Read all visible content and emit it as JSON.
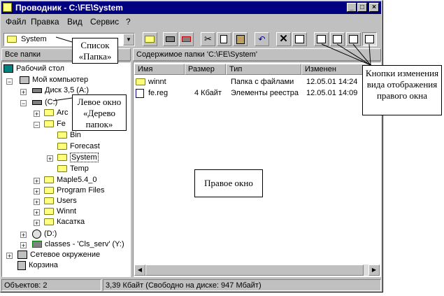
{
  "window": {
    "title": "Проводник - C:\\FE\\System"
  },
  "menu": [
    "Файл",
    "Правка",
    "Вид",
    "Сервис",
    "?"
  ],
  "address_combo": {
    "value": "System"
  },
  "left_pane": {
    "header": "Все папки",
    "tree": [
      {
        "label": "Рабочий стол",
        "icon": "desktop-icon"
      },
      {
        "label": "Мой компьютер",
        "icon": "computer-icon"
      },
      {
        "label": "Диск 3,5 (A:)",
        "icon": "floppy-icon"
      },
      {
        "label": "(C:)",
        "icon": "drive-icon"
      },
      {
        "label": "Arc",
        "icon": "folder-icon"
      },
      {
        "label": "Fe",
        "icon": "folder-open-icon"
      },
      {
        "label": "Bin",
        "icon": "folder-icon"
      },
      {
        "label": "Forecast",
        "icon": "folder-icon"
      },
      {
        "label": "System",
        "icon": "folder-open-icon"
      },
      {
        "label": "Temp",
        "icon": "folder-icon"
      },
      {
        "label": "Maple5.4_0",
        "icon": "folder-icon"
      },
      {
        "label": "Program Files",
        "icon": "folder-icon"
      },
      {
        "label": "Users",
        "icon": "folder-icon"
      },
      {
        "label": "Winnt",
        "icon": "folder-icon"
      },
      {
        "label": "Касатка",
        "icon": "folder-icon"
      },
      {
        "label": "(D:)",
        "icon": "cdrom-icon"
      },
      {
        "label": "classes - 'Cls_serv' (Y:)",
        "icon": "network-drive-icon"
      },
      {
        "label": "Сетевое окружение",
        "icon": "network-icon"
      },
      {
        "label": "Корзина",
        "icon": "recycle-bin-icon"
      }
    ]
  },
  "right_pane": {
    "header": "Содержимое папки 'C:\\FE\\System'",
    "columns": [
      "Имя",
      "Размер",
      "Тип",
      "Изменен"
    ],
    "rows": [
      {
        "name": "winnt",
        "size": "",
        "type": "Папка с файлами",
        "modified": "12.05.01 14:24"
      },
      {
        "name": "fe.reg",
        "size": "4 Кбайт",
        "type": "Элементы реестра",
        "modified": "12.05.01 14:09"
      }
    ]
  },
  "status": {
    "left": "Объектов: 2",
    "right": "3,39 Кбайт (Свободно на диске: 947 Мбайт)"
  },
  "callouts": {
    "combo": "Список «Папка»",
    "tree": "Левое окно «Дерево папок»",
    "right": "Правое окно",
    "view": "Кнопки изменения вида отображения правого окна"
  }
}
